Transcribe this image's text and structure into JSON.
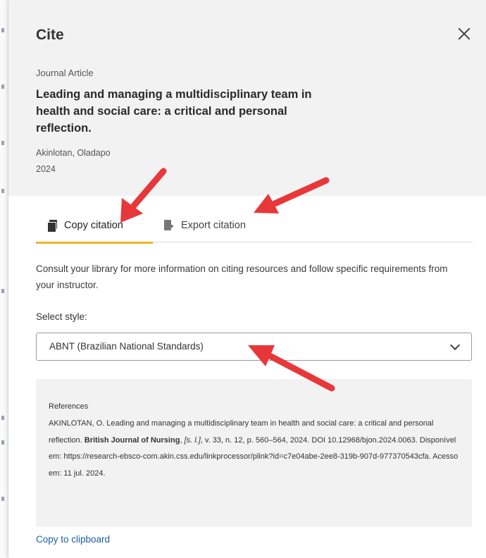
{
  "dialog": {
    "title": "Cite",
    "close_label": "×"
  },
  "record": {
    "type": "Journal Article",
    "title": "Leading and managing a multidisciplinary team in health and social care: a critical and personal reflection.",
    "author": "Akinlotan, Oladapo",
    "year": "2024"
  },
  "tabs": [
    {
      "label": "Copy citation",
      "icon": "copy-icon",
      "active": true
    },
    {
      "label": "Export citation",
      "icon": "export-icon",
      "active": false
    }
  ],
  "info_text": "Consult your library for more information on citing resources and follow specific requirements from your instructor.",
  "style_select": {
    "label": "Select style:",
    "value": "ABNT (Brazilian National Standards)"
  },
  "citation": {
    "heading": "References",
    "part1": "AKINLOTAN, O. Leading and managing a multidisciplinary team in health and social care: a critical and personal reflection. ",
    "journal": "British Journal of Nursing",
    "part2": ", ",
    "place": "[s. l.]",
    "part3": ", v. 33, n. 12, p. 560–564, 2024. DOI 10.12968/bjon.2024.0063. Disponível em: https://research-ebsco-com.akin.css.edu/linkprocessor/plink?id=c7e04abe-2ee8-319b-907d-977370543cfa. Acesso em: 11 jul. 2024."
  },
  "copy_link": "Copy to clipboard",
  "colors": {
    "tab_accent": "#f0b429",
    "link": "#1a5fa8",
    "annotation_arrow": "#e8373a"
  }
}
